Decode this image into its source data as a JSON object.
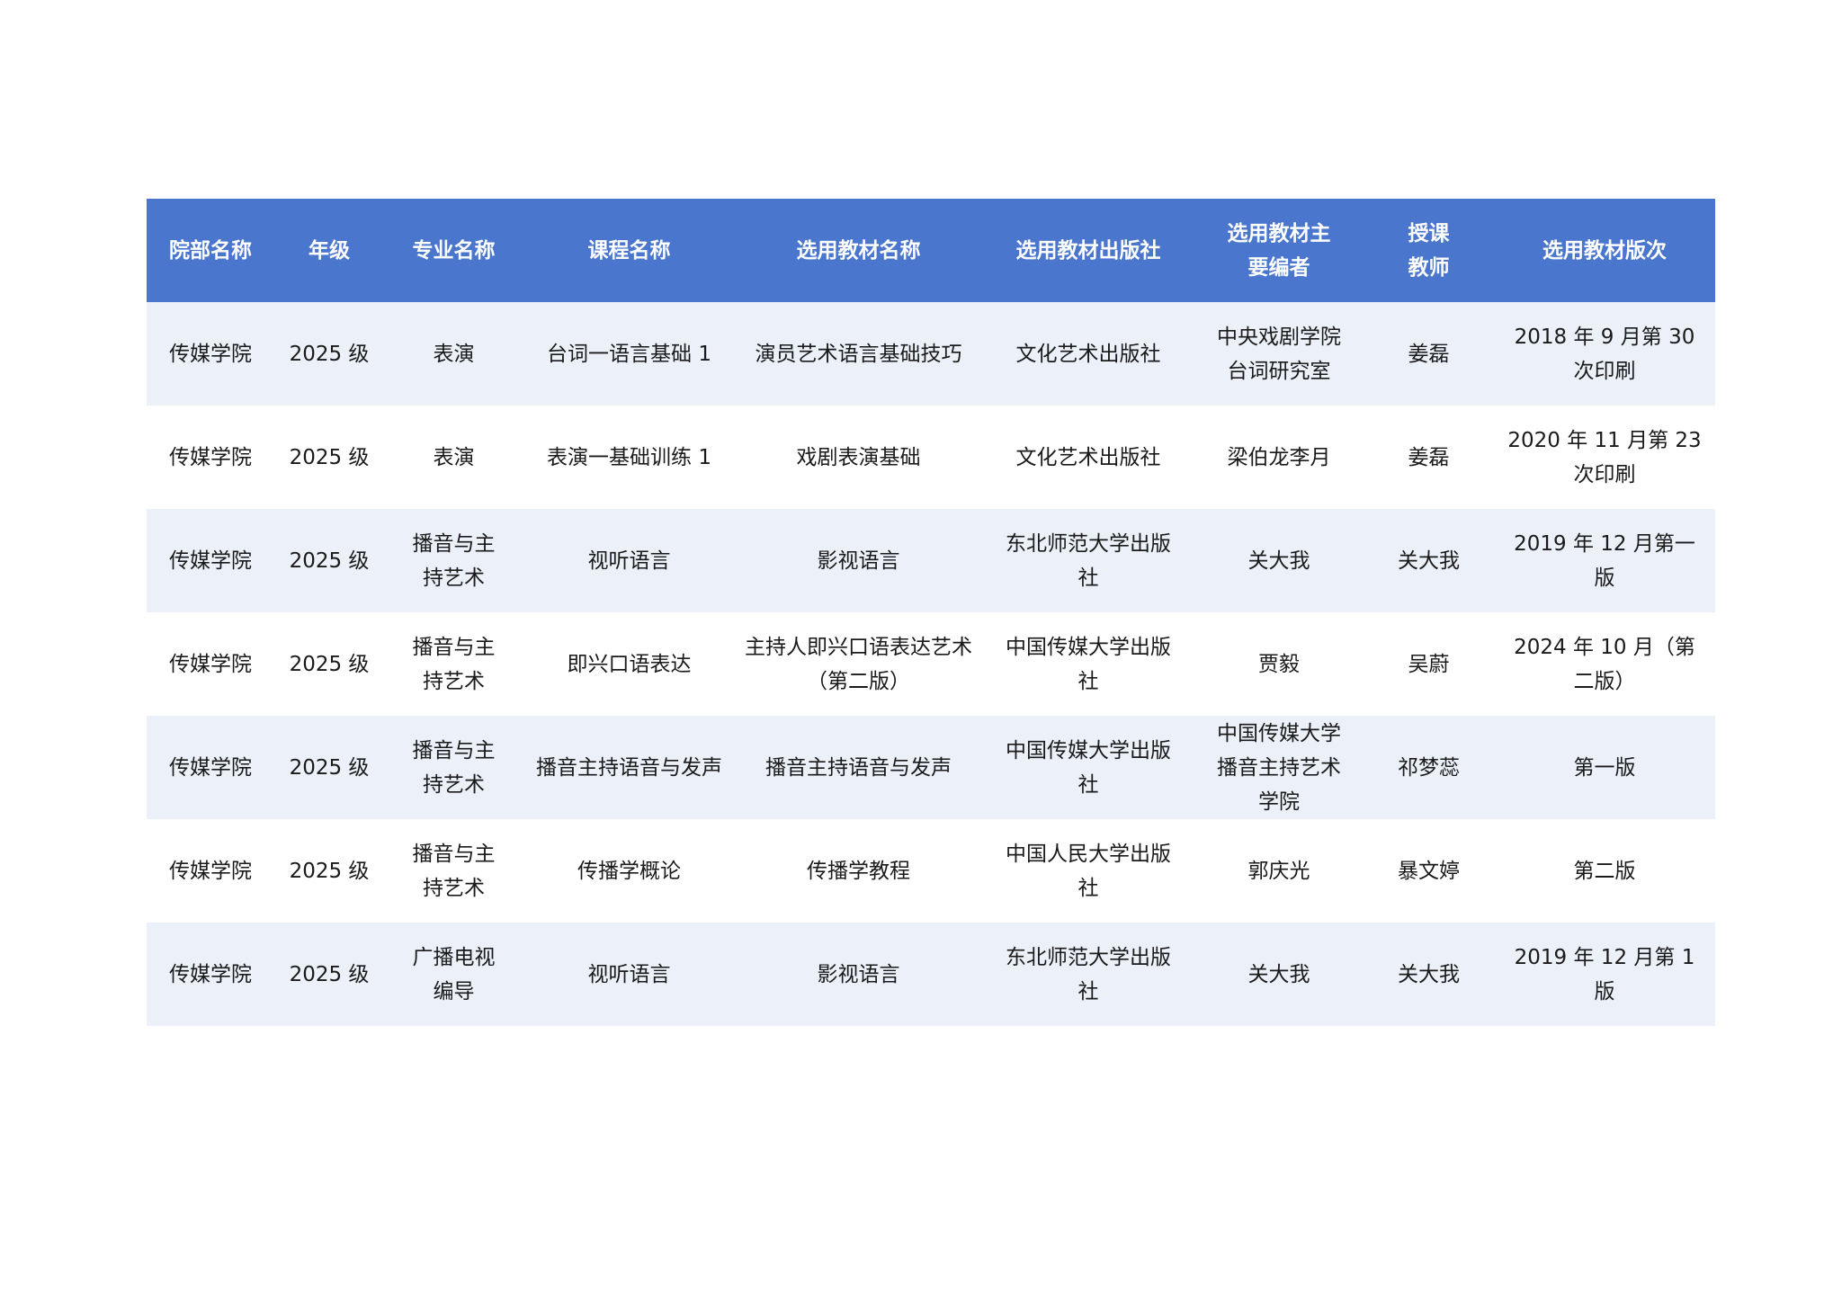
{
  "table": {
    "headers": [
      "院部名称",
      "年级",
      "专业名称",
      "课程名称",
      "选用教材名称",
      "选用教材出版社",
      "选用教材主要编者",
      "授课教师",
      "选用教材版次"
    ],
    "rows": [
      [
        "传媒学院",
        "2025 级",
        "表演",
        "台词一语言基础 1",
        "演员艺术语言基础技巧",
        "文化艺术出版社",
        "中央戏剧学院台词研究室",
        "姜磊",
        "2018 年 9 月第 30 次印刷"
      ],
      [
        "传媒学院",
        "2025 级",
        "表演",
        "表演一基础训练 1",
        "戏剧表演基础",
        "文化艺术出版社",
        "梁伯龙李月",
        "姜磊",
        "2020 年 11 月第 23 次印刷"
      ],
      [
        "传媒学院",
        "2025 级",
        "播音与主持艺术",
        "视听语言",
        "影视语言",
        "东北师范大学出版社",
        "关大我",
        "关大我",
        "2019 年 12 月第一版"
      ],
      [
        "传媒学院",
        "2025 级",
        "播音与主持艺术",
        "即兴口语表达",
        "主持人即兴口语表达艺术（第二版）",
        "中国传媒大学出版社",
        "贾毅",
        "吴蔚",
        "2024 年 10 月（第二版）"
      ],
      [
        "传媒学院",
        "2025 级",
        "播音与主持艺术",
        "播音主持语音与发声",
        "播音主持语音与发声",
        "中国传媒大学出版社",
        "中国传媒大学播音主持艺术学院",
        "祁梦蕊",
        "第一版"
      ],
      [
        "传媒学院",
        "2025 级",
        "播音与主持艺术",
        "传播学概论",
        "传播学教程",
        "中国人民大学出版社",
        "郭庆光",
        "暴文婷",
        "第二版"
      ],
      [
        "传媒学院",
        "2025 级",
        "广播电视编导",
        "视听语言",
        "影视语言",
        "东北师范大学出版社",
        "关大我",
        "关大我",
        "2019 年 12 月第 1 版"
      ]
    ]
  }
}
